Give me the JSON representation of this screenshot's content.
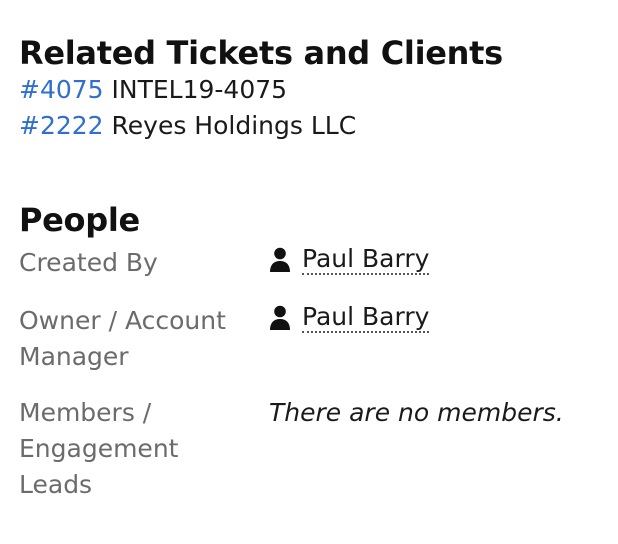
{
  "related": {
    "title": "Related Tickets and Clients",
    "items": [
      {
        "id": "#4075",
        "name": "INTEL19-4075"
      },
      {
        "id": "#2222",
        "name": "Reyes Holdings LLC"
      }
    ]
  },
  "people": {
    "title": "People",
    "created_by": {
      "label": "Created By",
      "value": "Paul Barry",
      "icon": "user-icon"
    },
    "owner": {
      "label": "Owner / Account Manager",
      "value": "Paul Barry",
      "icon": "user-icon"
    },
    "members": {
      "label": "Members / Engagement Leads",
      "value": "There are no members."
    }
  },
  "colors": {
    "link": "#2f6fd0",
    "label": "#6b6b6b",
    "text": "#1a1a1a"
  }
}
